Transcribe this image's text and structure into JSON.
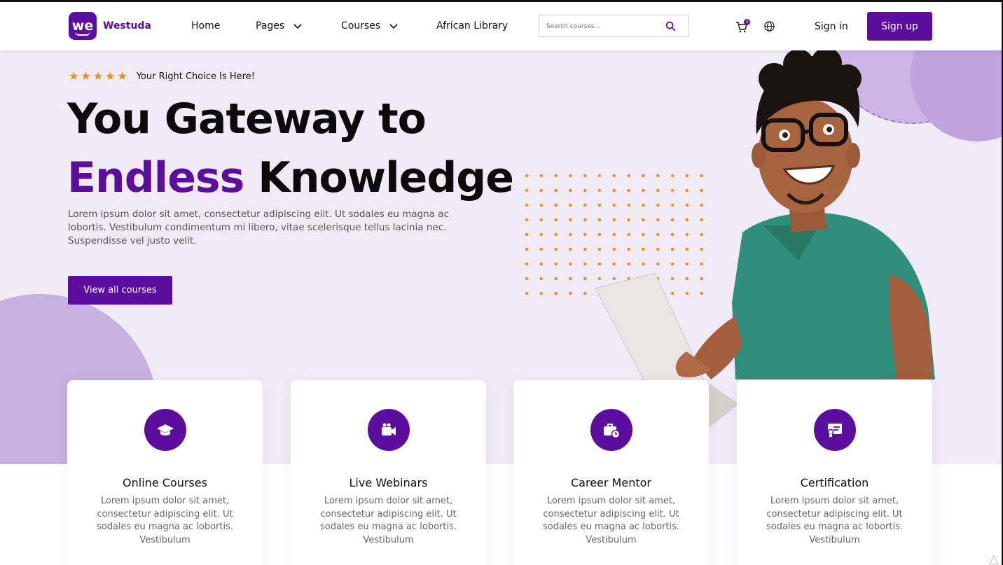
{
  "brand": {
    "name": "Westuda",
    "logo_text": "we",
    "color": "#5b0e9e"
  },
  "nav": {
    "links": [
      {
        "label": "Home"
      },
      {
        "label": "Pages"
      },
      {
        "label": "Courses"
      },
      {
        "label": "African Library"
      }
    ],
    "search_placeholder": "Search courses...",
    "cart_count": "3",
    "sign_in": "Sign in",
    "sign_up": "Sign up"
  },
  "hero": {
    "rating_stars": 5,
    "tagline": "Your Right Choice Is Here!",
    "headline_line1": "You Gateway to",
    "headline_accent": "Endless",
    "headline_rest": "Knowledge",
    "description": "Lorem ipsum dolor sit amet, consectetur adipiscing elit. Ut sodales eu magna ac lobortis. Vestibulum condimentum mi libero, vitae scelerisque tellus lacinia nec. Suspendisse vel justo velit.",
    "cta": "View all courses"
  },
  "features": [
    {
      "icon": "graduation-cap-icon",
      "title": "Online Courses",
      "description": "Lorem ipsum dolor sit amet, consectetur adipiscing elit. Ut sodales eu magna ac lobortis. Vestibulum"
    },
    {
      "icon": "video-camera-icon",
      "title": "Live Webinars",
      "description": "Lorem ipsum dolor sit amet, consectetur adipiscing elit. Ut sodales eu magna ac lobortis. Vestibulum"
    },
    {
      "icon": "briefcase-clock-icon",
      "title": "Career Mentor",
      "description": "Lorem ipsum dolor sit amet, consectetur adipiscing elit. Ut sodales eu magna ac lobortis. Vestibulum"
    },
    {
      "icon": "certificate-icon",
      "title": "Certification",
      "description": "Lorem ipsum dolor sit amet, consectetur adipiscing elit. Ut sodales eu magna ac lobortis. Vestibulum"
    }
  ],
  "colors": {
    "accent": "#5b0e9e",
    "star": "#f58a07",
    "hero_bg": "#f1ebf7",
    "dots": "#f58a07"
  }
}
